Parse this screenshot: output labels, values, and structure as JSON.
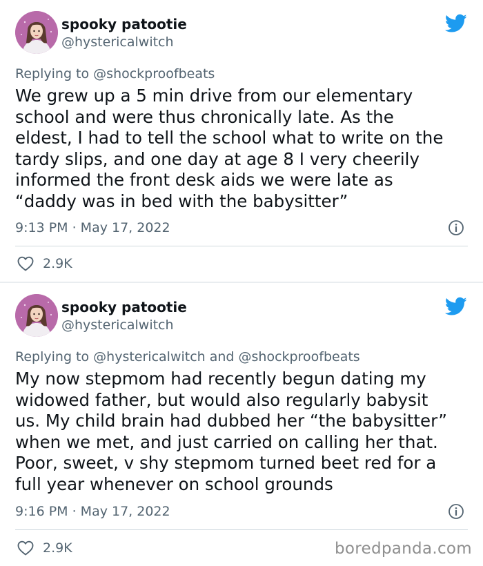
{
  "colors": {
    "twitter_blue": "#1d9bf0",
    "text_primary": "#0f1419",
    "text_secondary": "#536471",
    "divider": "#cfd9de"
  },
  "icons": {
    "bird": "twitter-bird-icon",
    "info": "info-circle-icon",
    "like": "heart-outline-icon"
  },
  "tweets": [
    {
      "author_name": "spooky patootie",
      "author_handle": "@hystericalwitch",
      "replying_prefix": "Replying to",
      "replying_to": "@shockproofbeats",
      "body": "We grew up a 5 min drive from our elementary\nschool and were thus chronically late. As the\neldest, I had to tell the school what to write on the\ntardy slips, and one day at age 8 I very cheerily\ninformed the front desk aids we were late as\n“daddy was in bed with the babysitter”",
      "timestamp": "9:13 PM · May 17, 2022",
      "likes": "2.9K"
    },
    {
      "author_name": "spooky patootie",
      "author_handle": "@hystericalwitch",
      "replying_prefix": "Replying to",
      "replying_to": "@hystericalwitch and @shockproofbeats",
      "body": "My now stepmom had recently begun dating my\nwidowed father, but would also regularly babysit\nus. My child brain had dubbed her “the babysitter”\nwhen we met, and just carried on calling her that.\nPoor, sweet, v shy stepmom turned beet red for a\nfull year whenever on school grounds",
      "timestamp": "9:16 PM · May 17, 2022",
      "likes": "2.9K"
    }
  ],
  "watermark": "boredpanda.com"
}
